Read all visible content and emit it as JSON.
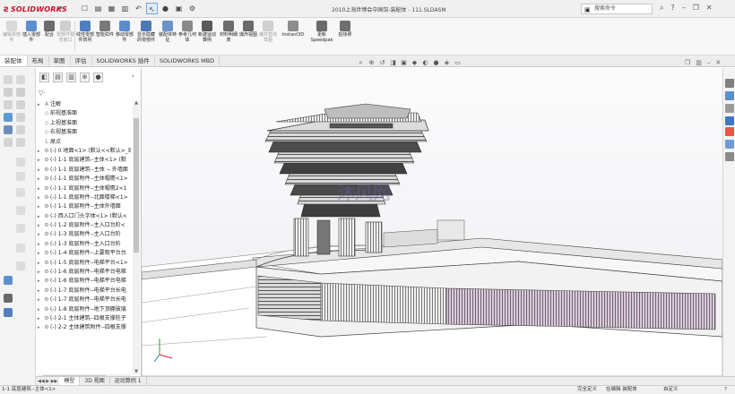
{
  "app": {
    "logo_text": "SOLIDWORKS",
    "document_title": "2010上海世博会中国馆-装配体 - 111.SLDASM"
  },
  "search": {
    "placeholder": "搜索命令"
  },
  "ribbon": {
    "buttons": [
      "编辑零部件",
      "插入零部件",
      "配合",
      "零部件预览窗口",
      "线性零部件阵列",
      "智能扣件",
      "移动零部件",
      "显示隐藏的零部件",
      "装配体特征",
      "参考几何体",
      "新建运动算例",
      "材料明细表",
      "爆炸视图",
      "爆炸直线草图",
      "Instant3D",
      "更新Speedpak",
      "拍快照"
    ]
  },
  "tabs": [
    "装配体",
    "布局",
    "草图",
    "评估",
    "SOLIDWORKS 插件",
    "SOLIDWORKS MBD"
  ],
  "active_tab": "装配体",
  "tree": {
    "filter_icon": "filter-icon",
    "nodes": [
      {
        "icon": "annotation-icon",
        "label": "注解"
      },
      {
        "icon": "plane-icon",
        "label": "前视基准面"
      },
      {
        "icon": "plane-icon",
        "label": "上视基准面"
      },
      {
        "icon": "plane-icon",
        "label": "右视基准面"
      },
      {
        "icon": "origin-icon",
        "label": "原点"
      },
      {
        "icon": "part-icon",
        "label": "(-) 0 地面<1> (默认<<默认>_显"
      },
      {
        "icon": "part-icon",
        "label": "(-) 1-1 底层建筑--主体<1> (默"
      },
      {
        "icon": "part-icon",
        "label": "(-) 1-1 底层建筑--主体 -- 外墙面"
      },
      {
        "icon": "part-icon",
        "label": "(-) 1-1 底层附件--主体帽檐<1>"
      },
      {
        "icon": "part-icon",
        "label": "(-) 1-1 底层附件--主体帽檐2<1"
      },
      {
        "icon": "part-icon",
        "label": "(-) 1-1 底层附件--北面楼梯<1>"
      },
      {
        "icon": "part-icon",
        "label": "(-) 1-1 底层附件--主体外墙面"
      },
      {
        "icon": "part-icon",
        "label": "(-) 西入口门头字体<1> (默认<"
      },
      {
        "icon": "part-icon",
        "label": "(-) 1-2 底层附件--主入口台阶<"
      },
      {
        "icon": "part-icon",
        "label": "(-) 1-3 底层附件--主入口台阶"
      },
      {
        "icon": "part-icon",
        "label": "(-) 1-3 底层附件--主入口台阶"
      },
      {
        "icon": "part-icon",
        "label": "(-) 1-4 底层附件--上要观平台台"
      },
      {
        "icon": "part-icon",
        "label": "(-) 1-5 底层附件--电梯平台<1>"
      },
      {
        "icon": "part-icon",
        "label": "(-) 1-6 底层附件--电梯平台电梯"
      },
      {
        "icon": "part-icon",
        "label": "(-) 1-6 底层附件--电梯平台电梯"
      },
      {
        "icon": "part-icon",
        "label": "(-) 1-7 底层附件--电梯平台长电"
      },
      {
        "icon": "part-icon",
        "label": "(-) 1-7 底层附件--电梯平台长电"
      },
      {
        "icon": "part-icon",
        "label": "(-) 1-8 底层附件--地下顶棚玻璃"
      },
      {
        "icon": "part-icon",
        "label": "(-) 2-1 主体建筑--四根支撑柱子"
      },
      {
        "icon": "part-icon",
        "label": "(-) 2-2 主体建筑附件--四根支撑"
      }
    ]
  },
  "bottom_tabs": [
    "模型",
    "3D 视图",
    "运动算例 1"
  ],
  "active_bottom_tab": "模型",
  "status": {
    "left": "1-1 底层建筑--主体<1>",
    "mode1": "完全定义",
    "mode2": "在编辑 装配体",
    "units": "自定义",
    "help": "?"
  },
  "watermark": "沐风网",
  "colors": {
    "accent": "#c8102e",
    "panel": "#f3f3f3",
    "glass_band": "#d8bfd8"
  }
}
